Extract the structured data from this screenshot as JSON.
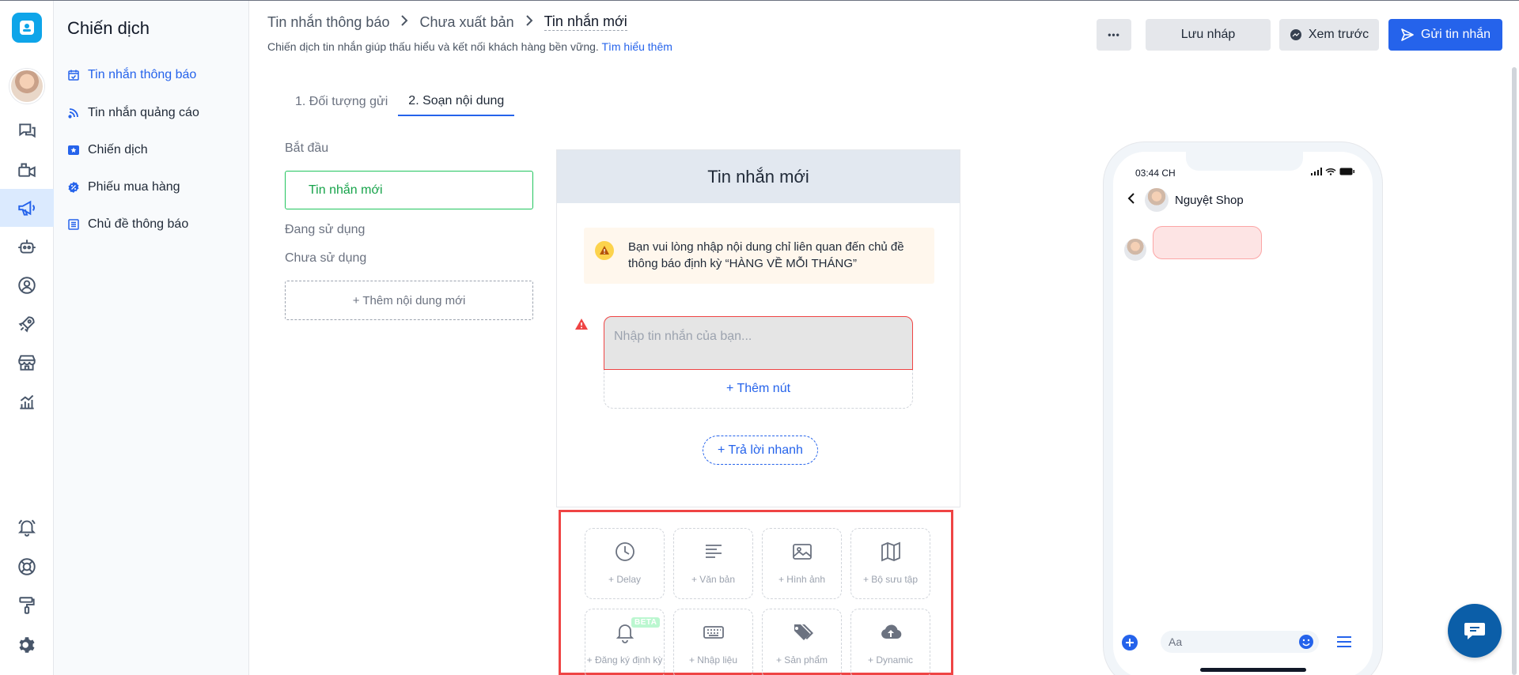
{
  "app": {
    "title": "Chiến dịch"
  },
  "sidebar": {
    "items": [
      {
        "label": "Tin nhắn thông báo",
        "icon": "calendar-check-icon",
        "active": true
      },
      {
        "label": "Tin nhắn quảng cáo",
        "icon": "rss-icon",
        "active": false
      },
      {
        "label": "Chiến dịch",
        "icon": "star-badge-icon",
        "active": false
      },
      {
        "label": "Phiếu mua hàng",
        "icon": "discount-badge-icon",
        "active": false
      },
      {
        "label": "Chủ đề thông báo",
        "icon": "list-icon",
        "active": false
      }
    ]
  },
  "rail": {
    "icons": [
      "chat-icon",
      "video-icon",
      "megaphone-icon",
      "bot-icon",
      "user-circle-icon",
      "rocket-icon",
      "store-icon",
      "chart-icon",
      "bell-icon",
      "globe-icon",
      "paint-roller-icon",
      "settings-icon"
    ],
    "active": "megaphone-icon"
  },
  "header": {
    "breadcrumb": [
      "Tin nhắn thông báo",
      "Chưa xuất bản",
      "Tin nhắn mới"
    ],
    "subtitle": "Chiến dịch tin nhắn giúp thấu hiểu và kết nối khách hàng bền vững.",
    "learn_more": "Tìm hiểu thêm",
    "more_label": "•••",
    "draft_label": "Lưu nháp",
    "preview_label": "Xem trước",
    "send_label": "Gửi tin nhắn"
  },
  "tabs": [
    {
      "label": "1. Đối tượng gửi",
      "active": false
    },
    {
      "label": "2. Soạn nội dung",
      "active": true
    }
  ],
  "flow": {
    "start_label": "Bắt đầu",
    "new_message": "Tin nhắn mới",
    "in_use": "Đang sử dụng",
    "not_used": "Chưa sử dụng",
    "add_content": "+ Thêm nội dung mới"
  },
  "editor": {
    "title": "Tin nhắn mới",
    "warning": "Bạn vui lòng nhập nội dung chỉ liên quan đến chủ đề thông báo định kỳ “HÀNG VỀ MỖI THÁNG”",
    "input_placeholder": "Nhập tin nhắn của bạn...",
    "add_button": "+ Thêm nút",
    "quick_reply": "+ Trả lời nhanh"
  },
  "palette": {
    "blocks": [
      {
        "label": "+ Delay",
        "icon": "clock-icon"
      },
      {
        "label": "+ Văn bản",
        "icon": "text-icon"
      },
      {
        "label": "+ Hình ảnh",
        "icon": "image-icon"
      },
      {
        "label": "+ Bộ sưu tập",
        "icon": "map-icon"
      },
      {
        "label": "+ Đăng ký định kỳ",
        "icon": "bell-icon",
        "badge": "BETA"
      },
      {
        "label": "+ Nhập liệu",
        "icon": "keyboard-icon"
      },
      {
        "label": "+ Sản phẩm",
        "icon": "tags-icon"
      },
      {
        "label": "+ Dynamic",
        "icon": "cloud-upload-icon"
      }
    ]
  },
  "phone": {
    "time": "03:44 CH",
    "shop_name": "Nguyệt Shop",
    "input_placeholder": "Aa"
  },
  "colors": {
    "accent": "#2563eb",
    "success": "#22c55e",
    "error": "#ef4444",
    "warning_bg": "#fff7ed"
  }
}
